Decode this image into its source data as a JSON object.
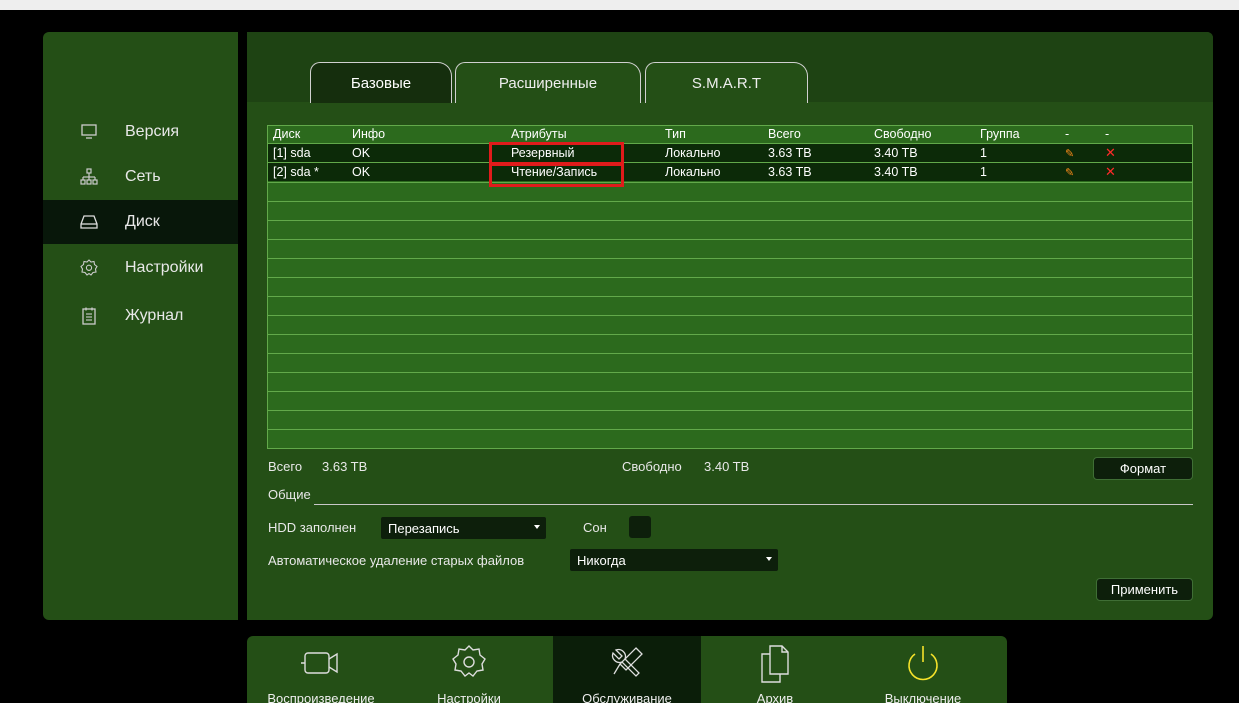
{
  "sidebar": {
    "items": [
      {
        "label": "Версия",
        "icon": "monitor-icon"
      },
      {
        "label": "Сеть",
        "icon": "network-icon"
      },
      {
        "label": "Диск",
        "icon": "disk-icon",
        "active": true
      },
      {
        "label": "Настройки",
        "icon": "gear-icon"
      },
      {
        "label": "Журнал",
        "icon": "log-icon"
      }
    ]
  },
  "tabs": [
    {
      "label": "Базовые",
      "active": true
    },
    {
      "label": "Расширенные"
    },
    {
      "label": "S.M.A.R.T"
    }
  ],
  "table": {
    "headers": [
      "Диск",
      "Инфо",
      "Атрибуты",
      "Тип",
      "Всего",
      "Свободно",
      "Группа",
      "-",
      "-"
    ],
    "rows": [
      {
        "disk": "[1] sda",
        "info": "OK",
        "attr": "Резервный",
        "type": "Локально",
        "total": "3.63 TB",
        "free": "3.40 TB",
        "group": "1"
      },
      {
        "disk": "[2] sda *",
        "info": "OK",
        "attr": "Чтение/Запись",
        "type": "Локально",
        "total": "3.63 TB",
        "free": "3.40 TB",
        "group": "1"
      }
    ]
  },
  "summary": {
    "total_label": "Всего",
    "total_value": "3.63 TB",
    "free_label": "Свободно",
    "free_value": "3.40 TB"
  },
  "format_button": "Формат",
  "general_label": "Общие",
  "hdd_full": {
    "label": "HDD заполнен",
    "value": "Перезапись"
  },
  "sleep": {
    "label": "Сон"
  },
  "auto_delete": {
    "label": "Автоматическое удаление старых файлов",
    "value": "Никогда"
  },
  "apply_button": "Применить",
  "bottom_nav": [
    {
      "label": "Воспроизведение",
      "icon": "playback-icon"
    },
    {
      "label": "Настройки",
      "icon": "settings-icon"
    },
    {
      "label": "Обслуживание",
      "icon": "maintenance-icon",
      "active": true
    },
    {
      "label": "Архив",
      "icon": "archive-icon"
    },
    {
      "label": "Выключение",
      "icon": "power-icon"
    }
  ],
  "colors": {
    "panel": "#244f16",
    "table": "#2c6a1d",
    "active": "#08170a",
    "highlight": "#e01b1b"
  }
}
